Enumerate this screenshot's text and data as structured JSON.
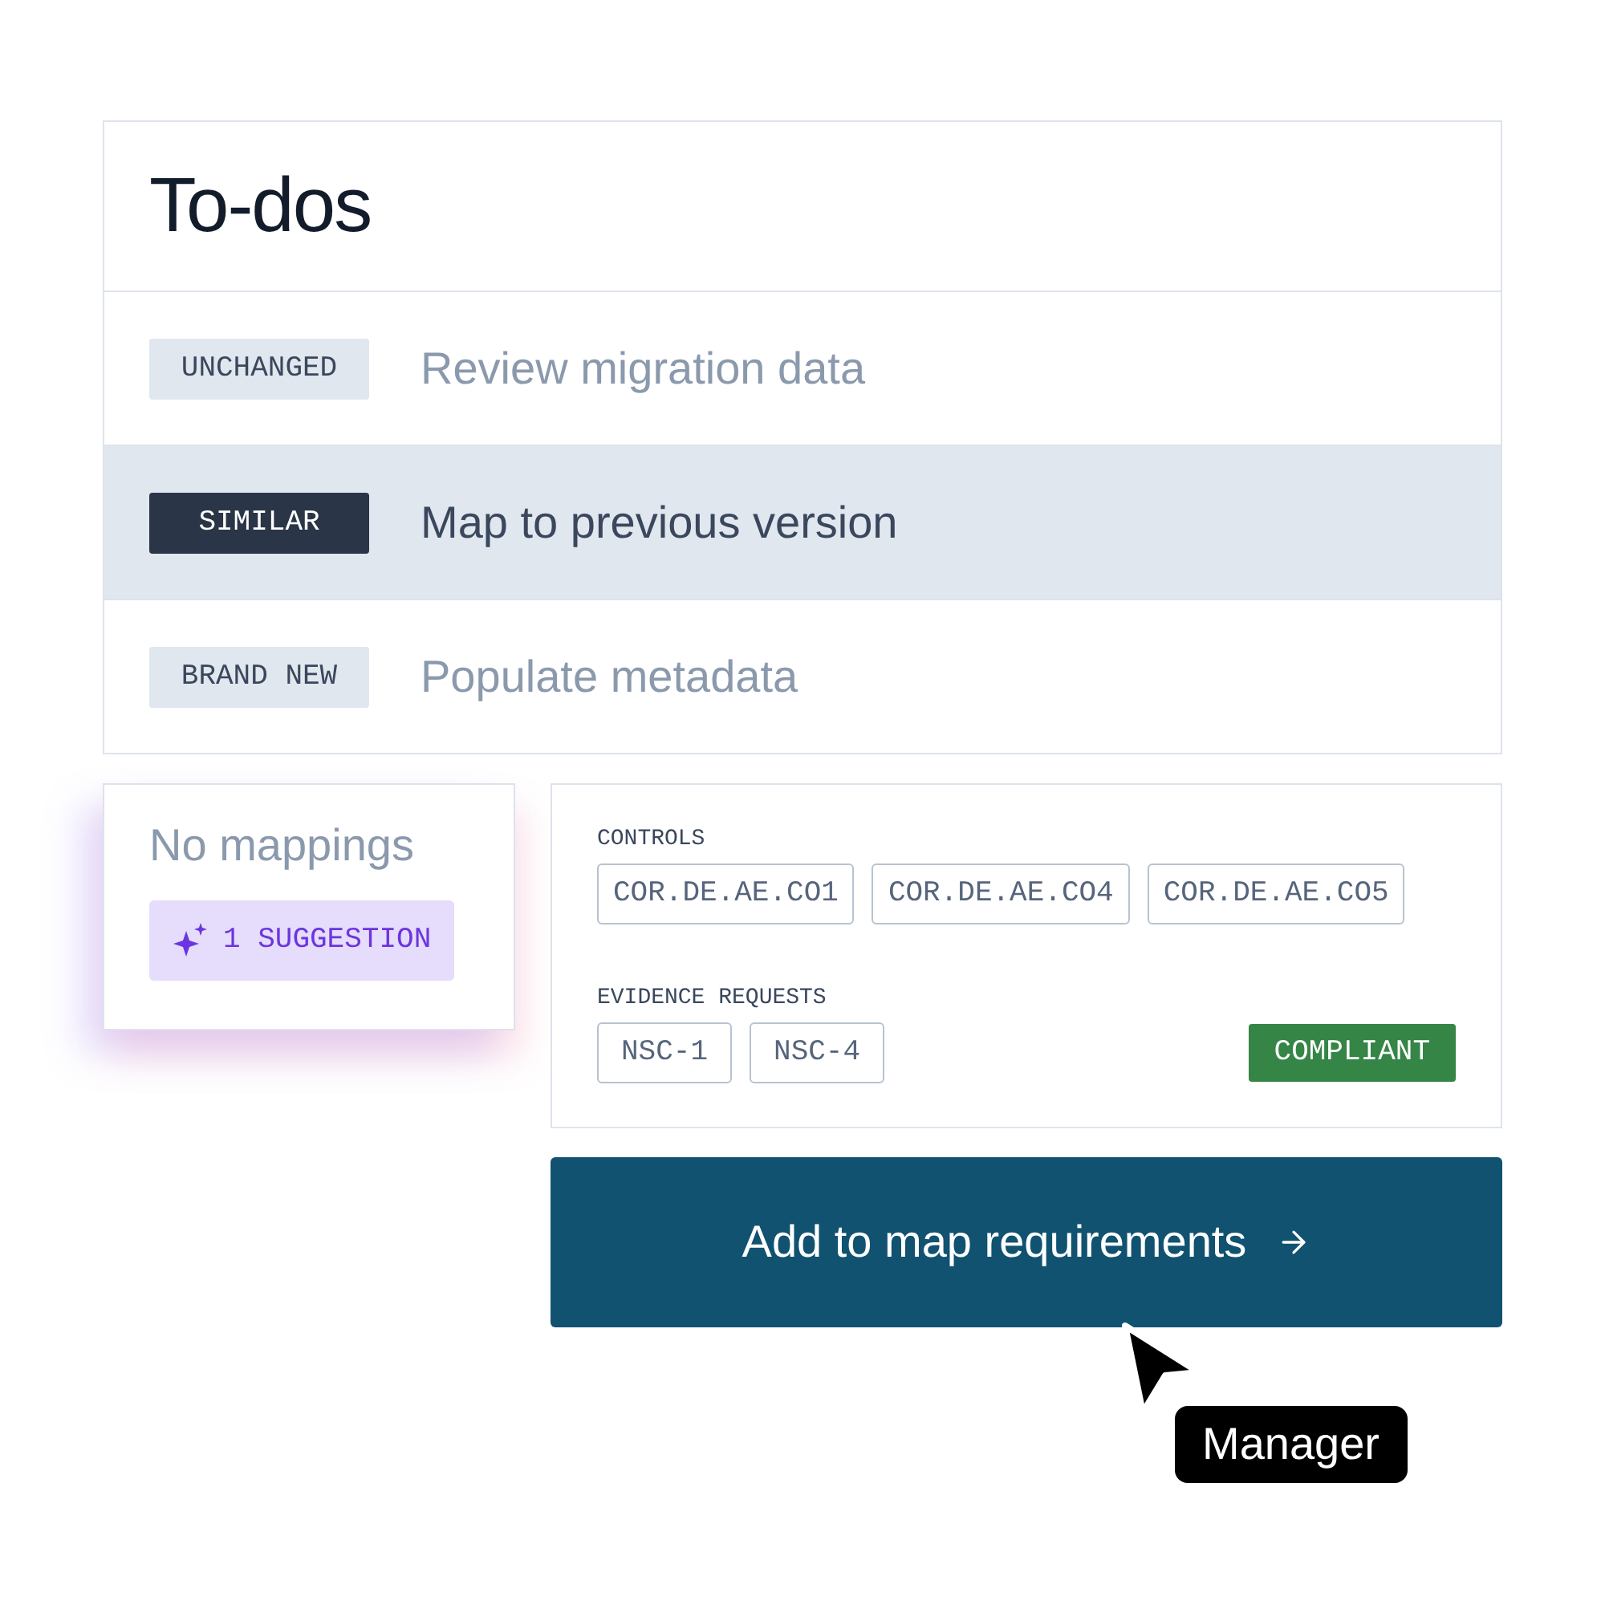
{
  "todos": {
    "title": "To-dos",
    "rows": [
      {
        "tag": "UNCHANGED",
        "label": "Review migration data",
        "selected": false
      },
      {
        "tag": "SIMILAR",
        "label": "Map to previous version",
        "selected": true
      },
      {
        "tag": "BRAND NEW",
        "label": "Populate metadata",
        "selected": false
      }
    ]
  },
  "mappings": {
    "title": "No mappings",
    "suggestion": "1 SUGGESTION"
  },
  "details": {
    "controls_label": "CONTROLS",
    "controls": [
      "COR.DE.AE.CO1",
      "COR.DE.AE.CO4",
      "COR.DE.AE.CO5"
    ],
    "evidence_label": "EVIDENCE REQUESTS",
    "evidence": [
      "NSC-1",
      "NSC-4"
    ],
    "status": "COMPLIANT"
  },
  "action_button": {
    "label": "Add to map requirements"
  },
  "cursor_tag": "Manager"
}
